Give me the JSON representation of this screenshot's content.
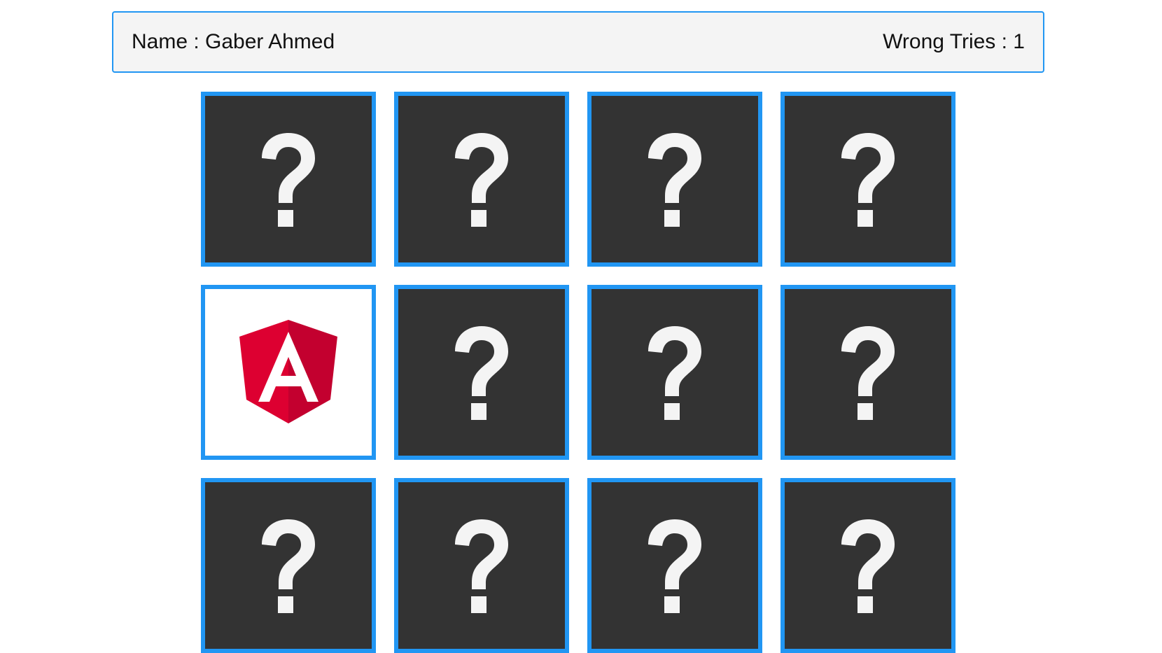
{
  "header": {
    "name_text": "Name : Gaber Ahmed",
    "wrong_tries_text": "Wrong Tries : 1"
  },
  "board": {
    "columns": 4,
    "hidden_icon": "question-mark-icon",
    "cards": [
      {
        "state": "hidden",
        "icon": "question-mark-icon"
      },
      {
        "state": "hidden",
        "icon": "question-mark-icon"
      },
      {
        "state": "hidden",
        "icon": "question-mark-icon"
      },
      {
        "state": "hidden",
        "icon": "question-mark-icon"
      },
      {
        "state": "flipped",
        "icon": "angular-logo-icon"
      },
      {
        "state": "hidden",
        "icon": "question-mark-icon"
      },
      {
        "state": "hidden",
        "icon": "question-mark-icon"
      },
      {
        "state": "hidden",
        "icon": "question-mark-icon"
      },
      {
        "state": "hidden",
        "icon": "question-mark-icon"
      },
      {
        "state": "hidden",
        "icon": "question-mark-icon"
      },
      {
        "state": "hidden",
        "icon": "question-mark-icon"
      },
      {
        "state": "hidden",
        "icon": "question-mark-icon"
      }
    ]
  },
  "colors": {
    "card_border": "#2196f3",
    "card_back": "#333333",
    "card_face": "#ffffff",
    "question_mark": "#f4f4f4",
    "angular_red": "#dd0031",
    "angular_dark_red": "#c3002f"
  }
}
